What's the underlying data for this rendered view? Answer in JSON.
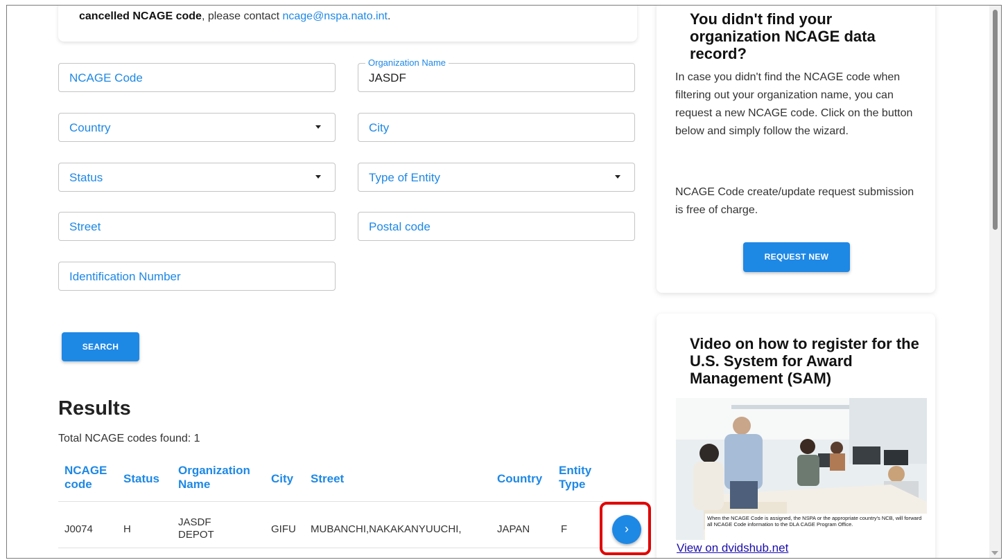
{
  "notice": {
    "bold": "cancelled NCAGE code",
    "text": ", please contact ",
    "email": "ncage@nspa.nato.int",
    "end": "."
  },
  "form": {
    "ncage_code": {
      "placeholder": "NCAGE Code"
    },
    "organization_name": {
      "label": "Organization Name",
      "value": "JASDF"
    },
    "country": {
      "placeholder": "Country"
    },
    "city": {
      "placeholder": "City"
    },
    "status": {
      "placeholder": "Status"
    },
    "type_of_entity": {
      "placeholder": "Type of Entity"
    },
    "street": {
      "placeholder": "Street"
    },
    "postal_code": {
      "placeholder": "Postal code"
    },
    "identification_number": {
      "placeholder": "Identification Number"
    },
    "search_label": "SEARCH"
  },
  "results": {
    "title": "Results",
    "total": "Total NCAGE codes found: 1",
    "columns": {
      "ncage_code_1": "NCAGE",
      "ncage_code_2": "code",
      "status": "Status",
      "org_name_1": "Organization",
      "org_name_2": "Name",
      "city": "City",
      "street": "Street",
      "country": "Country",
      "entity_type_1": "Entity",
      "entity_type_2": "Type"
    },
    "rows": [
      {
        "ncage_code": "J0074",
        "status": "H",
        "org_name_1": "JASDF",
        "org_name_2": "DEPOT",
        "city": "GIFU",
        "street": "MUBANCHI,NAKAKANYUUCHI,",
        "country": "JAPAN",
        "entity_type": "F",
        "action_icon": "chevron-right-icon"
      }
    ]
  },
  "sidebar": {
    "request_card": {
      "title": "You didn't find your organization NCAGE data record?",
      "para1": "In case you didn't find the NCAGE code when filtering out your organization name, you can request a new NCAGE code. Click on the button below and simply follow the wizard.",
      "para2": "NCAGE Code create/update request submission is free of charge.",
      "button_label": "REQUEST NEW"
    },
    "video_card": {
      "title": "Video on how to register for the U.S. System for Award Management (SAM)",
      "caption": "When the NCAGE Code is assigned, the NSPA or the appropriate country's NCB, will forward all NCAGE Code information to the DLA CAGE Program Office.",
      "link_text": "View on dvidshub.net"
    }
  },
  "colors": {
    "accent": "#1e88e5",
    "highlight": "#e00000"
  }
}
